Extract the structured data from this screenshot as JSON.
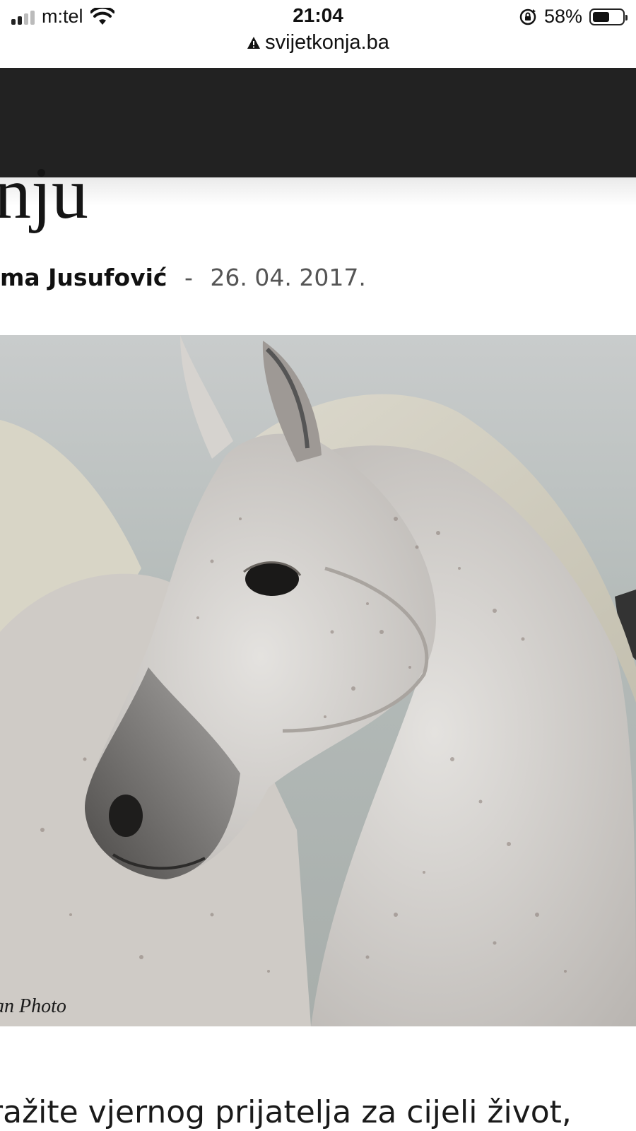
{
  "status_bar": {
    "carrier": "m:tel",
    "time": "21:04",
    "battery_percent": "58%",
    "battery_level": 0.58,
    "signal_bars_active": 2,
    "icons": [
      "signal-icon",
      "wifi-icon",
      "rotation-lock-icon",
      "battery-icon"
    ]
  },
  "browser": {
    "url": "svijetkonja.ba",
    "security_icon": "warning-icon"
  },
  "article": {
    "title_fragment": "nju",
    "author": "ma Jusufović",
    "separator": "-",
    "date": "26. 04. 2017.",
    "image": {
      "description_icon": "horse-photo",
      "credit": "an Photo"
    },
    "body_first_line": "ražite vjernog prijatelja  za cijeli  život,"
  },
  "colors": {
    "header_bg": "#222222",
    "text": "#111111",
    "meta_text": "#555555"
  }
}
